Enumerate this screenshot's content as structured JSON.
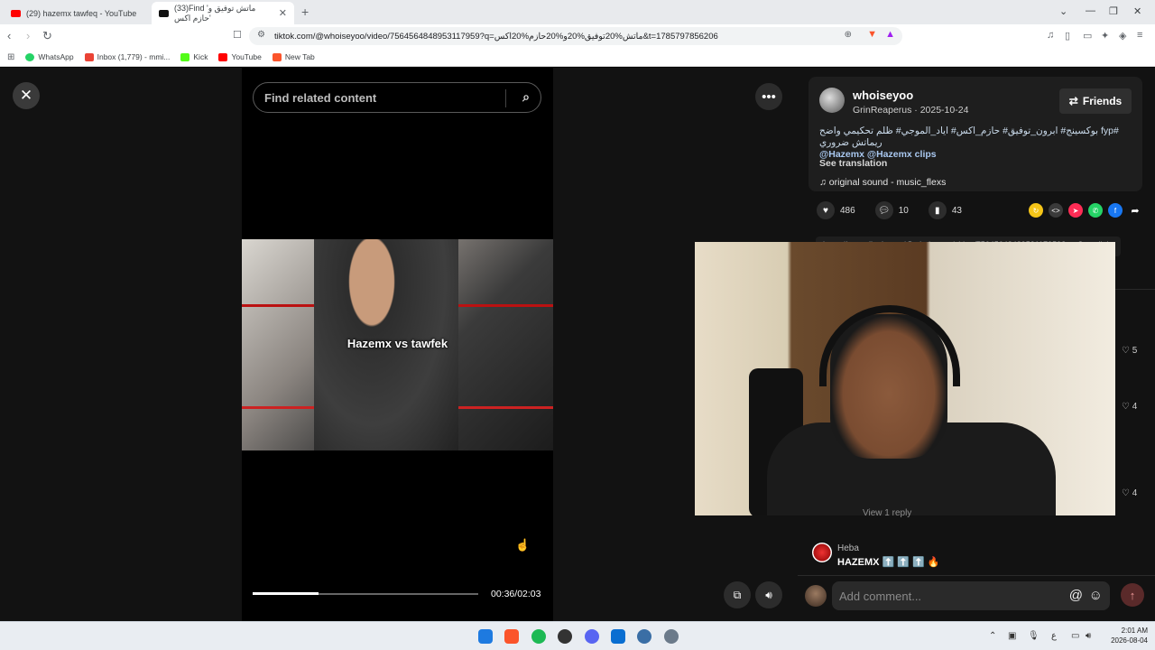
{
  "browser": {
    "tabs": [
      {
        "title": "(29) hazemx tawfeq - YouTube",
        "active": false
      },
      {
        "title": "(33)Find 'ماتش توفيق و حازم اكس'",
        "active": true
      }
    ],
    "new_tab_glyph": "+",
    "url": "tiktok.com/@whoiseyoo/video/7564564848953117959?q=ماتش%20توفيق%20و%20حازم%20اكس&t=1785797856206",
    "bookmarks": [
      {
        "label": "WhatsApp",
        "color": "#25d366"
      },
      {
        "label": "Inbox (1,779) - mmi...",
        "color": "#ea4335"
      },
      {
        "label": "Kick",
        "color": "#53fc18"
      },
      {
        "label": "YouTube",
        "color": "#ff0000"
      },
      {
        "label": "New Tab",
        "color": "#fb542b"
      }
    ]
  },
  "tiktok": {
    "search_placeholder": "Find related content",
    "video_caption": "Hazemx vs tawfek",
    "time": "00:36/02:03",
    "progress": 0.29,
    "author": {
      "username": "whoiseyoo",
      "subline": "GrinReaperus · 2025-10-24",
      "follow_label": "Friends"
    },
    "description": {
      "hashtags_line": "#fyp بوكسينج# ابرون_توفيق# حازم_اكس# اياد_الموجي# ظلم تحكيمي واضح ريماتش ضروري",
      "mentions_line": "@Hazemx @Hazemx clips",
      "see_translation": "See translation"
    },
    "sound": "original sound - music_flexs",
    "stats": {
      "likes": "486",
      "comments": "10",
      "saves": "43"
    },
    "link_strip": "https://www.tiktok.com/@whoiseyoo/video/7564564848953117959?q=    Copy link",
    "like_counts": [
      "5",
      "4",
      "4"
    ],
    "view_reply": "View 1 reply",
    "comment": {
      "name": "Heba",
      "text": "HAZEMX ⬆️ ⬆️ ⬆️ 🔥"
    },
    "add_comment_placeholder": "Add comment..."
  },
  "taskbar": {
    "time": "2:01 AM",
    "date": "2026-08-04",
    "lang": "ع"
  },
  "colors": {
    "accent": "#fe2c55",
    "link": "#a9c8f0"
  }
}
